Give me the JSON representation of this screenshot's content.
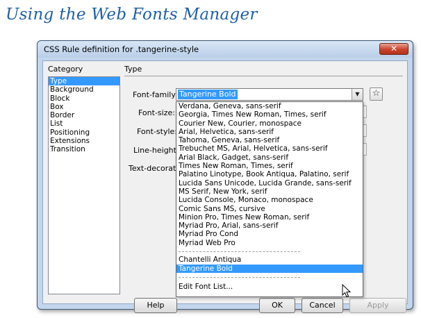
{
  "page": {
    "heading": "Using the Web Fonts Manager"
  },
  "dialog": {
    "title": "CSS Rule definition for .tangerine-style",
    "close_label": "✕",
    "category_label": "Category",
    "categories": [
      "Type",
      "Background",
      "Block",
      "Box",
      "Border",
      "List",
      "Positioning",
      "Extensions",
      "Transition"
    ],
    "selected_category": "Type",
    "panel_title": "Type",
    "fields": {
      "font_family_label": "Font-family:",
      "font_family_value": "Tangerine Bold",
      "font_size_label": "Font-size:",
      "font_style_label": "Font-style:",
      "line_height_label": "Line-height:",
      "text_decoration_label": "Text-decoratio"
    },
    "dropdown": {
      "options": [
        "Verdana, Geneva, sans-serif",
        "Georgia, Times New Roman, Times, serif",
        "Courier New, Courier, monospace",
        "Arial, Helvetica, sans-serif",
        "Tahoma, Geneva, sans-serif",
        "Trebuchet MS, Arial, Helvetica, sans-serif",
        "Arial Black, Gadget, sans-serif",
        "Times New Roman, Times, serif",
        "Palatino Linotype, Book Antiqua, Palatino, serif",
        "Lucida Sans Unicode, Lucida Grande, sans-serif",
        "MS Serif, New York, serif",
        "Lucida Console, Monaco, monospace",
        "Comic Sans MS, cursive",
        "Minion Pro, Times New Roman, serif",
        "Myriad Pro, Arial, sans-serif",
        "Myriad Pro Cond",
        "Myriad Web Pro"
      ],
      "web_fonts": [
        "Chantelli Antiqua",
        "Tangerine Bold"
      ],
      "selected": "Tangerine Bold",
      "edit_label": "Edit Font List..."
    },
    "buttons": {
      "help": "Help",
      "ok": "OK",
      "cancel": "Cancel",
      "apply": "Apply"
    }
  },
  "icons": {
    "dropdown_arrow": "chevron-down-icon",
    "star": "star-icon",
    "close": "close-icon",
    "cursor": "mouse-pointer-icon"
  }
}
